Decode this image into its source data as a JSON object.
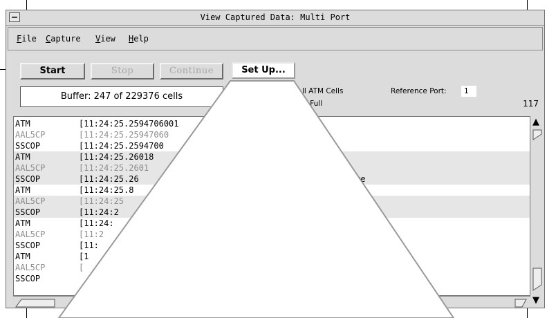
{
  "window": {
    "title": "View Captured Data: Multi Port"
  },
  "menu": [
    {
      "label_u": "F",
      "label_rest": "ile"
    },
    {
      "label_u": "C",
      "label_rest": "apture"
    },
    {
      "label_u": "V",
      "label_rest": "iew"
    },
    {
      "label_u": "H",
      "label_rest": "elp"
    }
  ],
  "toolbar": {
    "start": "Start",
    "stop": "Stop",
    "continue": "Continue",
    "setup": "Set Up..."
  },
  "buffer_text": "Buffer: 247 of 229376 cells",
  "info": {
    "atm_cells": "ll ATM Cells",
    "full": "il Full",
    "reference_label": "Reference Port:",
    "reference_value": "1",
    "count": "117"
  },
  "rows": [
    {
      "proto": "ATM",
      "time": "[11:24:25.2594706001",
      "style": "dark"
    },
    {
      "proto": "AAL5CP",
      "time": "[11:24:25.25947060",
      "style": "gray"
    },
    {
      "proto": "SSCOP",
      "time": "[11:24:25.2594700",
      "style": "dark"
    },
    {
      "proto": "ATM",
      "time": "[11:24:25.26018",
      "style": "dark"
    },
    {
      "proto": "AAL5CP",
      "time": "[11:24:25.2601",
      "style": "gray"
    },
    {
      "proto": "SSCOP",
      "time": "[11:24:25.26",
      "style": "dark",
      "note": "re"
    },
    {
      "proto": "ATM",
      "time": "[11:24:25.8",
      "style": "dark"
    },
    {
      "proto": "AAL5CP",
      "time": "[11:24:25",
      "style": "gray"
    },
    {
      "proto": "SSCOP",
      "time": "[11:24:2",
      "style": "dark"
    },
    {
      "proto": "ATM",
      "time": "[11:24:",
      "style": "dark"
    },
    {
      "proto": "AAL5CP",
      "time": "[11:2",
      "style": "gray"
    },
    {
      "proto": "SSCOP",
      "time": "[11:",
      "style": "dark"
    },
    {
      "proto": "ATM",
      "time": "[1",
      "style": "dark"
    },
    {
      "proto": "AAL5CP",
      "time": "[",
      "style": "gray"
    },
    {
      "proto": "SSCOP",
      "time": "",
      "style": "dark"
    }
  ],
  "icons": {
    "scroll_up": "up-arrow",
    "scroll_down": "down-arrow",
    "window_menu": "window-menu"
  }
}
